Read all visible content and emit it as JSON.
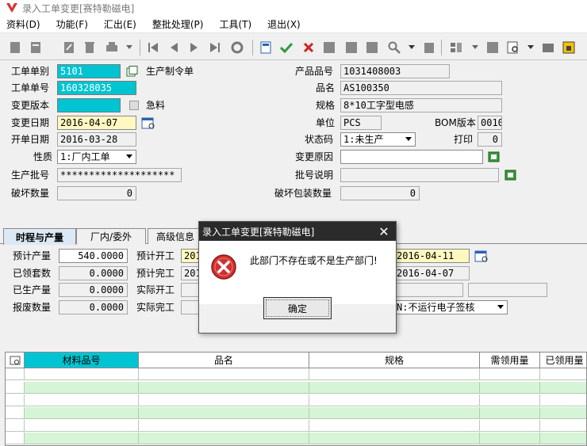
{
  "window": {
    "title": "录入工单变更[赛特勒磁电]"
  },
  "menu": [
    "资料(D)",
    "功能(F)",
    "汇出(E)",
    "整批处理(P)",
    "工具(T)",
    "退出(X)"
  ],
  "form": {
    "order_type_label": "工单单别",
    "order_type": "5101",
    "order_type_desc": "生产制令单",
    "order_no_label": "工单单号",
    "order_no": "160328035",
    "change_ver_label": "变更版本",
    "change_ver": "",
    "urgent_label": "急料",
    "change_date_label": "变更日期",
    "change_date": "2016-04-07",
    "open_date_label": "开单日期",
    "open_date": "2016-03-28",
    "nature_label": "性质",
    "nature": "1:厂内工单",
    "batch_label": "生产批号",
    "batch": "********************",
    "damage_label": "破坏数量",
    "damage": "0",
    "product_no_label": "产品品号",
    "product_no": "1031408003",
    "product_name_label": "品名",
    "product_name": "AS100350",
    "spec_label": "规格",
    "spec": "8*10工字型电感",
    "unit_label": "单位",
    "unit": "PCS",
    "bom_label": "BOM版本",
    "bom": "0010",
    "status_label": "状态码",
    "status": "1:未生产",
    "print_label": "打印",
    "print": "0",
    "reason_label": "变更原因",
    "reason": "",
    "batch_note_label": "批号说明",
    "batch_note": "",
    "damage_pkg_label": "破坏包装数量",
    "damage_pkg": "0"
  },
  "tabs": [
    "时程与产量",
    "厂内/委外",
    "高级信息"
  ],
  "schedule": {
    "plan_qty_label": "预计产量",
    "plan_qty": "540.0000",
    "received_label": "已领套数",
    "received": "0.0000",
    "produced_label": "已生产量",
    "produced": "0.0000",
    "scrap_label": "报废数量",
    "scrap": "0.0000",
    "plan_start_label": "预计开工",
    "plan_start": "201",
    "plan_end_label": "预计完工",
    "plan_end": "201",
    "actual_start_label": "实际开工",
    "actual_end_label": "实际完工",
    "date_a": "2016-04-11",
    "date_b": "2016-04-07",
    "sign_option": "N:不运行电子签核"
  },
  "grid": {
    "columns": [
      "材料品号",
      "品名",
      "规格",
      "需领用量",
      "已领用量"
    ]
  },
  "dialog": {
    "title": "录入工单变更[赛特勒磁电]",
    "message": "此部门不存在或不是生产部门!",
    "ok": "确定"
  },
  "colors": {
    "highlight": "#00c4d2",
    "dialog_title": "#2b2b2b",
    "error": "#d32f2f",
    "required": "#fff8c0"
  }
}
